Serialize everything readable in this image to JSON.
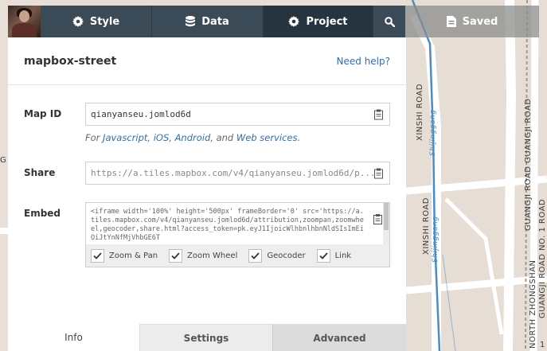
{
  "nav": {
    "tabs": [
      {
        "label": "Style",
        "icon": "gear-icon"
      },
      {
        "label": "Data",
        "icon": "database-icon"
      },
      {
        "label": "Project",
        "icon": "gear-icon"
      }
    ],
    "search_icon": "search-icon",
    "saved_label": "Saved",
    "saved_icon": "document-icon"
  },
  "panel": {
    "title": "mapbox-street",
    "help_link": "Need help?",
    "map_id": {
      "label": "Map ID",
      "value": "qianyanseu.jomlod6d"
    },
    "for_line": {
      "prefix": "For",
      "links": [
        "Javascript",
        "iOS",
        "Android"
      ],
      "and": "and",
      "last_link": "Web services",
      "period": "."
    },
    "share": {
      "label": "Share",
      "value": "https://a.tiles.mapbox.com/v4/qianyanseu.jomlod6d/p..."
    },
    "embed": {
      "label": "Embed",
      "code": "<iframe width='100%' height='500px' frameBorder='0' src='https://a.tiles.mapbox.com/v4/qianyanseu.jomlod6d/attribution,zoompan,zoomwheel,geocoder,share.html?access_token=pk.eyJ1IjoicWlhbnlhbnNldSIsImEiOiJtYnNfMjVhbGE6T",
      "options": [
        {
          "label": "Zoom & Pan",
          "checked": true
        },
        {
          "label": "Zoom Wheel",
          "checked": true
        },
        {
          "label": "Geocoder",
          "checked": true
        },
        {
          "label": "Link",
          "checked": true
        }
      ]
    },
    "bottom_tabs": [
      "Info",
      "Settings",
      "Advanced"
    ]
  },
  "map": {
    "labels": {
      "xinshi_upper": "XINSHI ROAD",
      "xinshi_lower": "XINSHI ROAD",
      "water_upper": "Shijinggang",
      "water_lower": "Shijinggang",
      "guangji": "GUANGJI ROAD GUANGJI ROAD",
      "zhongshan": "GUANGJI ROAD NO. 1 ROAD",
      "north_zhongshan": "NORTH ZHONGSHAN",
      "left_edge": "G",
      "right_edge": "1"
    },
    "colors": {
      "land": "#e8e0d8",
      "road": "#ffffff",
      "water": "#4a8cc6",
      "rail": "#9a9a9a"
    }
  },
  "colors": {
    "nav_dark": "#3b4a57",
    "nav_active": "#263440",
    "link_blue": "#2f6fb5"
  }
}
